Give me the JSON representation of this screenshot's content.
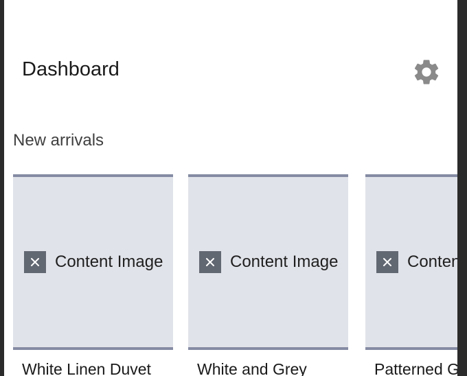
{
  "header": {
    "title": "Dashboard",
    "settings_icon": "gear-icon"
  },
  "section": {
    "title": "New arrivals"
  },
  "products": [
    {
      "image_placeholder": "Content Image",
      "image_icon": "close-icon",
      "title": "White Linen Duvet"
    },
    {
      "image_placeholder": "Content Image",
      "image_icon": "close-icon",
      "title": "White and Grey"
    },
    {
      "image_placeholder": "Content Image",
      "image_icon": "close-icon",
      "title": "Patterned G"
    }
  ],
  "colors": {
    "card_background": "#e1e3ea",
    "card_border": "#858ba3",
    "icon_gray": "#8a8a8a",
    "placeholder_box": "#626872"
  }
}
